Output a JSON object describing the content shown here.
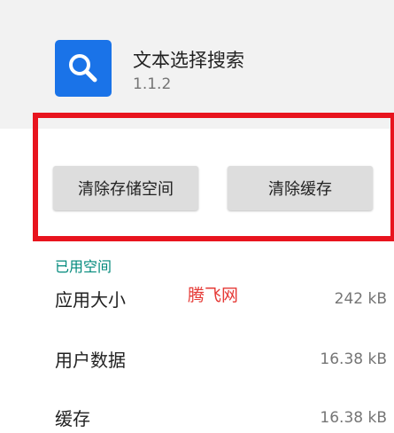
{
  "app": {
    "name": "文本选择搜索",
    "version": "1.1.2",
    "icon": "search-icon",
    "icon_color": "#1a73e8"
  },
  "actions": {
    "clear_storage_label": "清除存储空间",
    "clear_cache_label": "清除缓存"
  },
  "storage": {
    "section_title": "已用空间",
    "rows": [
      {
        "label": "应用大小",
        "value": "242 kB"
      },
      {
        "label": "用户数据",
        "value": "16.38 kB"
      },
      {
        "label": "缓存",
        "value": "16.38 kB"
      }
    ]
  },
  "watermark": "腾飞网",
  "colors": {
    "accent": "#00897b",
    "highlight": "#e8141e"
  }
}
